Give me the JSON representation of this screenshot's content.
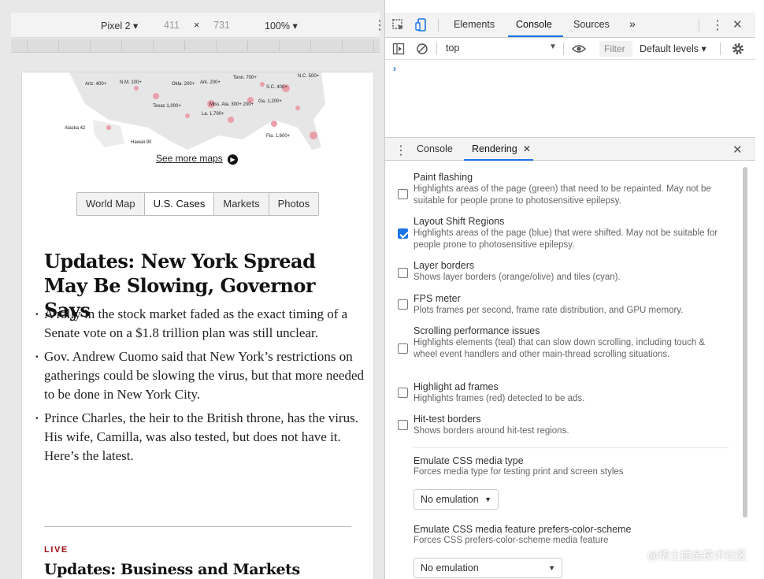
{
  "device_toolbar": {
    "device": "Pixel 2 ▾",
    "width": "411",
    "times": "×",
    "height": "731",
    "zoom": "100% ▾"
  },
  "article": {
    "map_link": "See more maps",
    "tabs": [
      "World Map",
      "U.S. Cases",
      "Markets",
      "Photos"
    ],
    "active_tab": "U.S. Cases",
    "headline": "Updates: New York Spread May Be Slowing, Governor Says",
    "bullets": [
      "A rally in the stock market faded as the exact timing of a Senate vote on a $1.8 trillion plan was still unclear.",
      "Gov. Andrew Cuomo said that New York’s restrictions on gatherings could be slowing the virus, but that more needed to be done in New York City.",
      "Prince Charles, the heir to the British throne, has the virus. His wife, Camilla, was also tested, but does not have it. Here’s the latest."
    ],
    "live_label": "LIVE",
    "second_headline": "Updates: Business and Markets",
    "map_labels": [
      {
        "text": "Ariz. 400+"
      },
      {
        "text": "N.M. 100+"
      },
      {
        "text": "Okla. 200+"
      },
      {
        "text": "Ark. 200+"
      },
      {
        "text": "Tenn. 700+"
      },
      {
        "text": "S.C. 400+"
      },
      {
        "text": "N.C. 500+"
      },
      {
        "text": "Texas 1,000+"
      },
      {
        "text": "Miss. Ala. 300+ 200+"
      },
      {
        "text": "Ga. 1,200+"
      },
      {
        "text": "La. 1,700+"
      },
      {
        "text": "Fla. 1,600+"
      },
      {
        "text": "Alaska 42"
      },
      {
        "text": "Hawaii 90"
      }
    ]
  },
  "devtools": {
    "tabs": [
      "Elements",
      "Console",
      "Sources",
      "»"
    ],
    "active_tab": "Console",
    "context": "top",
    "filter_placeholder": "Filter",
    "levels": "Default levels ▾",
    "prompt": "›",
    "drawer_tabs": [
      "Console",
      "Rendering"
    ],
    "drawer_active": "Rendering",
    "rendering_options": [
      {
        "title": "Paint flashing",
        "desc": "Highlights areas of the page (green) that need to be repainted. May not be suitable for people prone to photosensitive epilepsy.",
        "checked": false
      },
      {
        "title": "Layout Shift Regions",
        "desc": "Highlights areas of the page (blue) that were shifted. May not be suitable for people prone to photosensitive epilepsy.",
        "checked": true
      },
      {
        "title": "Layer borders",
        "desc": "Shows layer borders (orange/olive) and tiles (cyan).",
        "checked": false
      },
      {
        "title": "FPS meter",
        "desc": "Plots frames per second, frame rate distribution, and GPU memory.",
        "checked": false
      },
      {
        "title": "Scrolling performance issues",
        "desc": "Highlights elements (teal) that can slow down scrolling, including touch & wheel event handlers and other main-thread scrolling situations.",
        "checked": false
      },
      {
        "title": "Highlight ad frames",
        "desc": "Highlights frames (red) detected to be ads.",
        "checked": false
      },
      {
        "title": "Hit-test borders",
        "desc": "Shows borders around hit-test regions.",
        "checked": false
      }
    ],
    "media_type": {
      "title": "Emulate CSS media type",
      "desc": "Forces media type for testing print and screen styles",
      "value": "No emulation"
    },
    "color_scheme": {
      "title": "Emulate CSS media feature prefers-color-scheme",
      "desc": "Forces CSS prefers-color-scheme media feature",
      "value": "No emulation"
    }
  },
  "watermark": "@稀土掘金技术社区",
  "colors": {
    "accent": "#1a73e8",
    "live": "#a0101a"
  }
}
